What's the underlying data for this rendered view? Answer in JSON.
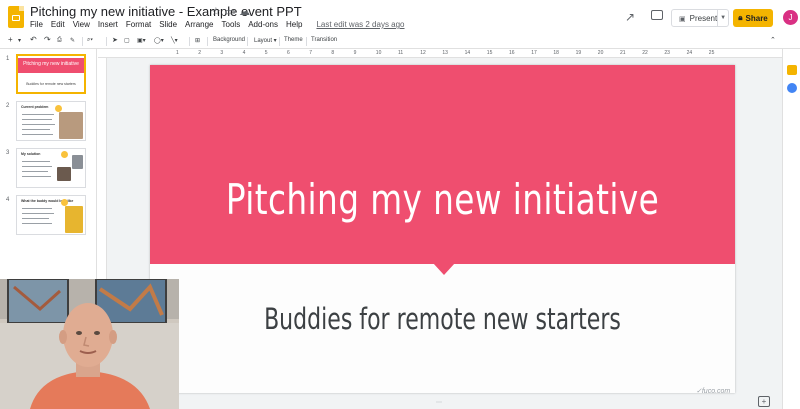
{
  "app": {
    "title": "Pitching my new initiative - Example event PPT",
    "last_edit": "Last edit was 2 days ago",
    "avatar_initial": "J",
    "accent_color": "#f4b400"
  },
  "title_icons": [
    "star-icon",
    "folder-icon",
    "cloud-icon"
  ],
  "menu": [
    "File",
    "Edit",
    "View",
    "Insert",
    "Format",
    "Slide",
    "Arrange",
    "Tools",
    "Add-ons",
    "Help"
  ],
  "header_buttons": {
    "present_label": "Present",
    "share_label": "Share"
  },
  "toolbar": {
    "background_label": "Background",
    "layout_label": "Layout",
    "theme_label": "Theme",
    "transition_label": "Transition"
  },
  "ruler": [
    "1",
    "2",
    "3",
    "4",
    "5",
    "6",
    "7",
    "8",
    "9",
    "10",
    "11",
    "12",
    "13",
    "14",
    "15",
    "16",
    "17",
    "18",
    "19",
    "20",
    "21",
    "22",
    "23",
    "24",
    "25"
  ],
  "filmstrip": {
    "slides": [
      {
        "number": "1",
        "title": "Pitching my new initiative",
        "subtitle": "Buddies for remote new starters"
      },
      {
        "number": "2",
        "heading": "Current problem"
      },
      {
        "number": "3",
        "heading": "My solution"
      },
      {
        "number": "4",
        "heading": "What the buddy would look like"
      }
    ]
  },
  "slide": {
    "title": "Pitching my new initiative",
    "subtitle": "Buddies for remote new starters",
    "band_color": "#ef4e6f"
  },
  "watermark": "✓fuco.com"
}
